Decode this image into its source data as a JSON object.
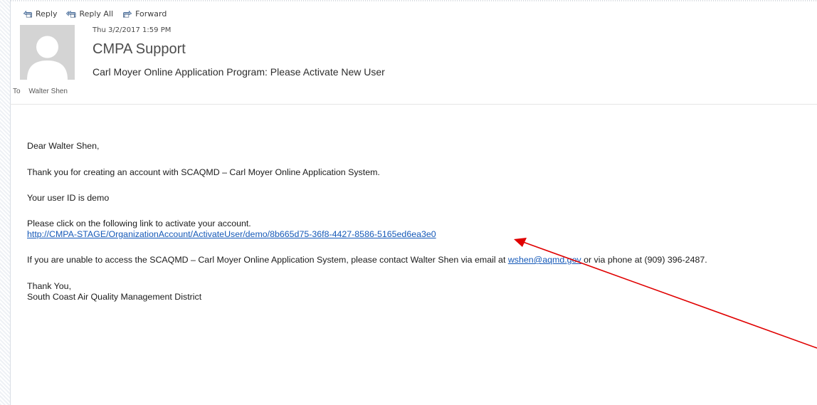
{
  "toolbar": {
    "reply_label": "Reply",
    "reply_all_label": "Reply All",
    "forward_label": "Forward"
  },
  "message": {
    "date": "Thu 3/2/2017 1:59 PM",
    "sender": "CMPA Support",
    "subject": "Carl Moyer Online Application Program: Please Activate New User",
    "to_label": "To",
    "recipient": "Walter Shen"
  },
  "body": {
    "greeting": "Dear Walter Shen,",
    "thanks_line": "Thank you for creating an account with SCAQMD – Carl Moyer Online Application System.",
    "user_id_line": "Your user ID is demo",
    "activate_instruction": "Please click on the following link to activate your account.",
    "activation_link": "http://CMPA-STAGE/OrganizationAccount/ActivateUser/demo/8b665d75-36f8-4427-8586-5165ed6ea3e0",
    "contact_prefix": "If you are unable to access the SCAQMD – Carl Moyer Online Application System, please contact Walter Shen via email at ",
    "contact_email": "wshen@aqmd.gov",
    "contact_suffix": " or via phone at (909) 396-2487.",
    "signoff": "Thank You,",
    "organization": "South Coast Air Quality Management District"
  },
  "colors": {
    "link": "#1559b8",
    "annotation_arrow": "#e00000",
    "avatar_bg": "#d4d4d4"
  }
}
